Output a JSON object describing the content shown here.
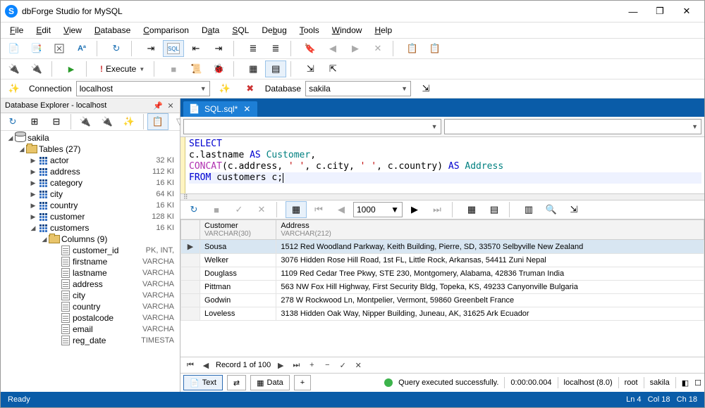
{
  "app": {
    "logo_letter": "S",
    "title": "dbForge Studio for MySQL"
  },
  "win": {
    "min": "—",
    "max": "❐",
    "close": "✕"
  },
  "menus": [
    "File",
    "Edit",
    "View",
    "Database",
    "Comparison",
    "Data",
    "SQL",
    "Debug",
    "Tools",
    "Window",
    "Help"
  ],
  "conn": {
    "conn_label": "Connection",
    "conn_value": "localhost",
    "db_label": "Database",
    "db_value": "sakila"
  },
  "explorer": {
    "title": "Database Explorer - localhost",
    "db": "sakila",
    "tables_label": "Tables (27)",
    "tables": [
      {
        "name": "actor",
        "meta": "32 KI"
      },
      {
        "name": "address",
        "meta": "112 KI"
      },
      {
        "name": "category",
        "meta": "16 KI"
      },
      {
        "name": "city",
        "meta": "64 KI"
      },
      {
        "name": "country",
        "meta": "16 KI"
      },
      {
        "name": "customer",
        "meta": "128 KI"
      },
      {
        "name": "customers",
        "meta": "16 KI"
      }
    ],
    "columns_label": "Columns (9)",
    "columns": [
      {
        "name": "customer_id",
        "type": "PK, INT,"
      },
      {
        "name": "firstname",
        "type": "VARCHA"
      },
      {
        "name": "lastname",
        "type": "VARCHA"
      },
      {
        "name": "address",
        "type": "VARCHA"
      },
      {
        "name": "city",
        "type": "VARCHA"
      },
      {
        "name": "country",
        "type": "VARCHA"
      },
      {
        "name": "postalcode",
        "type": "VARCHA"
      },
      {
        "name": "email",
        "type": "VARCHA"
      },
      {
        "name": "reg_date",
        "type": "TIMESTA"
      }
    ]
  },
  "doctab": {
    "label": "SQL.sql*"
  },
  "sql": {
    "l1_kw": "SELECT",
    "l2_pre": "  c.lastname ",
    "l2_as": "AS",
    "l2_alias": " Customer",
    "l2_post": ",",
    "l3_pre": "  ",
    "l3_fn": "CONCAT",
    "l3_open": "(c.address, ",
    "l3_s1": "' '",
    "l3_m1": ", c.city, ",
    "l3_s2": "' '",
    "l3_m2": ", c.country) ",
    "l3_as": "AS",
    "l3_alias": " Address",
    "l4_kw": "FROM",
    "l4_rest": " customers c",
    "l4_semi": ";"
  },
  "grid": {
    "page_size": "1000",
    "cols": [
      {
        "name": "Customer",
        "type": "VARCHAR(30)"
      },
      {
        "name": "Address",
        "type": "VARCHAR(212)"
      }
    ],
    "rows": [
      {
        "c": "Sousa",
        "a": "1512 Red Woodland Parkway, Keith Building, Pierre, SD, 33570 Selbyville New Zealand"
      },
      {
        "c": "Welker",
        "a": "3076 Hidden Rose Hill Road, 1st FL, Little Rock, Arkansas, 54411 Zuni Nepal"
      },
      {
        "c": "Douglass",
        "a": "1109 Red Cedar Tree Pkwy, STE 230, Montgomery, Alabama, 42836 Truman India"
      },
      {
        "c": "Pittman",
        "a": "563 NW Fox Hill Highway, First Security Bldg, Topeka, KS, 49233 Canyonville Bulgaria"
      },
      {
        "c": "Godwin",
        "a": "278 W Rockwood Ln, Montpelier, Vermont, 59860 Greenbelt France"
      },
      {
        "c": "Loveless",
        "a": "3138 Hidden Oak Way, Nipper Building, Juneau, AK, 31625 Ark Ecuador"
      }
    ],
    "pager_label": "Record 1 of 100"
  },
  "bottom": {
    "text": "Text",
    "data": "Data",
    "plus": "+",
    "status": "Query executed successfully.",
    "time": "0:00:00.004",
    "server": "localhost (8.0)",
    "user": "root",
    "db": "sakila"
  },
  "statusbar": {
    "ready": "Ready",
    "ln": "Ln 4",
    "col": "Col 18",
    "ch": "Ch 18"
  },
  "toolbar": {
    "execute": "Execute"
  }
}
